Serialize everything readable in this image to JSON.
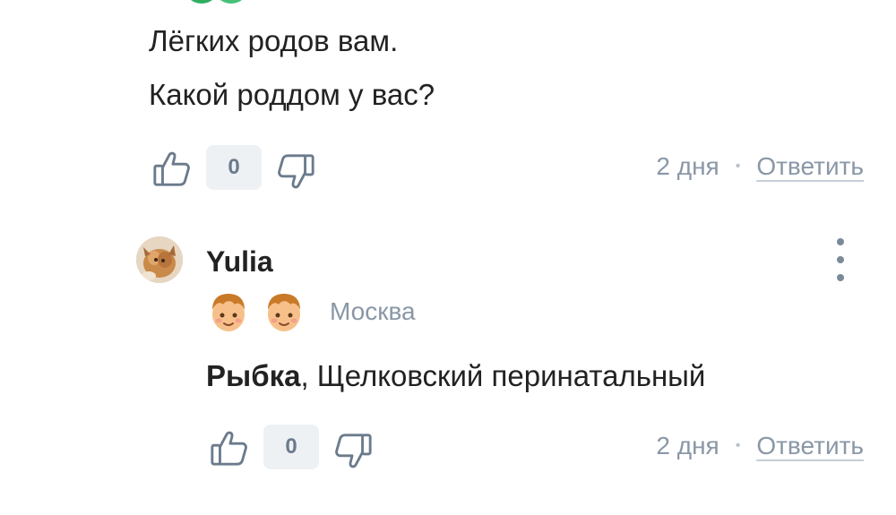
{
  "comment1": {
    "line1": "Лёгких родов вам.",
    "line2": "Какой роддом у вас?",
    "likes": "0",
    "time": "2 дня",
    "separator": "•",
    "reply_label": "Ответить"
  },
  "comment2": {
    "username": "Yulia",
    "city": "Москва",
    "mention": "Рыбка",
    "text": ", Щелковский перинатальный",
    "likes": "0",
    "time": "2 дня",
    "separator": "•",
    "reply_label": "Ответить"
  },
  "icons": {
    "like": "thumbs-up-icon",
    "dislike": "thumbs-down-icon",
    "more": "kebab-menu-icon",
    "badge": "boy-face-icon"
  },
  "colors": {
    "text": "#222222",
    "muted": "#8a97a6",
    "icon": "#6b7b8c",
    "count_bg": "#eef1f4"
  }
}
